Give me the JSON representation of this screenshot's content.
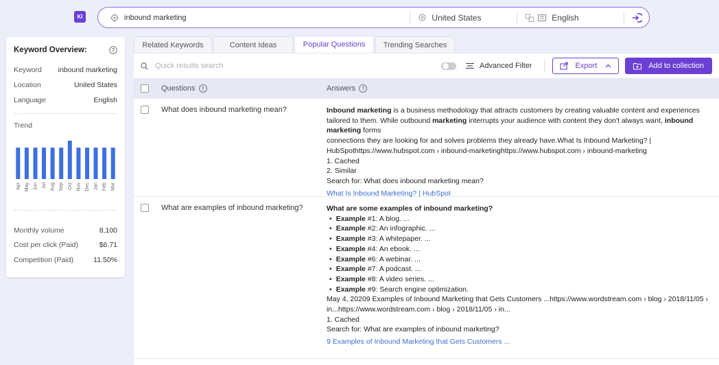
{
  "app": {
    "logo_text": "KI"
  },
  "search": {
    "keyword": "inbound marketing",
    "location": "United States",
    "language": "English"
  },
  "overview": {
    "title": "Keyword Overview:",
    "rows": [
      {
        "label": "Keyword",
        "value": "inbound marketing"
      },
      {
        "label": "Location",
        "value": "United States"
      },
      {
        "label": "Language",
        "value": "English"
      }
    ],
    "trend_label": "Trend",
    "trend": {
      "months": [
        "Apr",
        "May",
        "Jun",
        "Jul",
        "Aug",
        "Sep",
        "Oct",
        "Nov",
        "Dec",
        "Jan",
        "Feb",
        "Mar"
      ],
      "values": [
        8100,
        8100,
        8100,
        8100,
        8100,
        8100,
        9900,
        8100,
        8100,
        8100,
        8100,
        8100
      ]
    },
    "metrics": [
      {
        "label": "Monthly volume",
        "value": "8,100"
      },
      {
        "label": "Cost per click (Paid)",
        "value": "$6.71"
      },
      {
        "label": "Competition (Paid)",
        "value": "11.50%"
      }
    ]
  },
  "tabs": [
    {
      "label": "Related Keywords",
      "active": false
    },
    {
      "label": "Content Ideas",
      "active": false
    },
    {
      "label": "Popular Questions",
      "active": true
    },
    {
      "label": "Trending Searches",
      "active": false
    }
  ],
  "toolbar": {
    "search_placeholder": "Quick results search",
    "advanced_filter": "Advanced Filter",
    "export": "Export",
    "add_to_collection": "Add to collection"
  },
  "table": {
    "col_questions": "Questions",
    "col_answers": "Answers",
    "rows": [
      {
        "question": "What does inbound marketing mean?",
        "answer_lines": [
          "connections they are looking for and solves problems they already have.What Is Inbound Marketing? |",
          "HubSpothttps://www.hubspot.com › inbound-marketinghttps://www.hubspot.com › inbound-marketing",
          "1. Cached",
          "2. Similar",
          "Search for: What does inbound marketing mean?"
        ],
        "answer_intro": {
          "b1": "Inbound marketing",
          "t1": " is a business methodology that attracts customers by creating valuable content and experiences tailored to them. While outbound ",
          "b2": "marketing",
          "t2": " interrupts your audience with content they don't always want, ",
          "b3": "inbound marketing",
          "t3": " forms"
        },
        "link": "What Is Inbound Marketing? | HubSpot"
      },
      {
        "question": "What are examples of inbound marketing?",
        "answer_title": "What are some examples of inbound marketing?",
        "examples": [
          {
            "bold": "Example",
            "text": " #1: A blog. ..."
          },
          {
            "bold": "Example",
            "text": " #2: An infographic. ..."
          },
          {
            "bold": "Example",
            "text": " #3: A whitepaper. ..."
          },
          {
            "bold": "Example",
            "text": " #4: An ebook. ..."
          },
          {
            "bold": "Example",
            "text": " #6: A webinar. ..."
          },
          {
            "bold": "Example",
            "text": " #7: A podcast. ..."
          },
          {
            "bold": "Example",
            "text": " #8: A video series. ..."
          },
          {
            "bold": "Example",
            "text": " #9: Search engine optimization."
          }
        ],
        "answer_lines": [
          "May 4, 20209 Examples of Inbound Marketing that Gets Customers ...https://www.wordstream.com › blog › 2018/11/05 ›",
          "in...https://www.wordstream.com › blog › 2018/11/05 › in...",
          "1. Cached",
          "Search for: What are examples of inbound marketing?"
        ],
        "link": "9 Examples of Inbound Marketing that Gets Customers ..."
      }
    ]
  },
  "colors": {
    "accent": "#6b3fd4",
    "link": "#3b6fd4",
    "bar": "#3d6fe0"
  }
}
